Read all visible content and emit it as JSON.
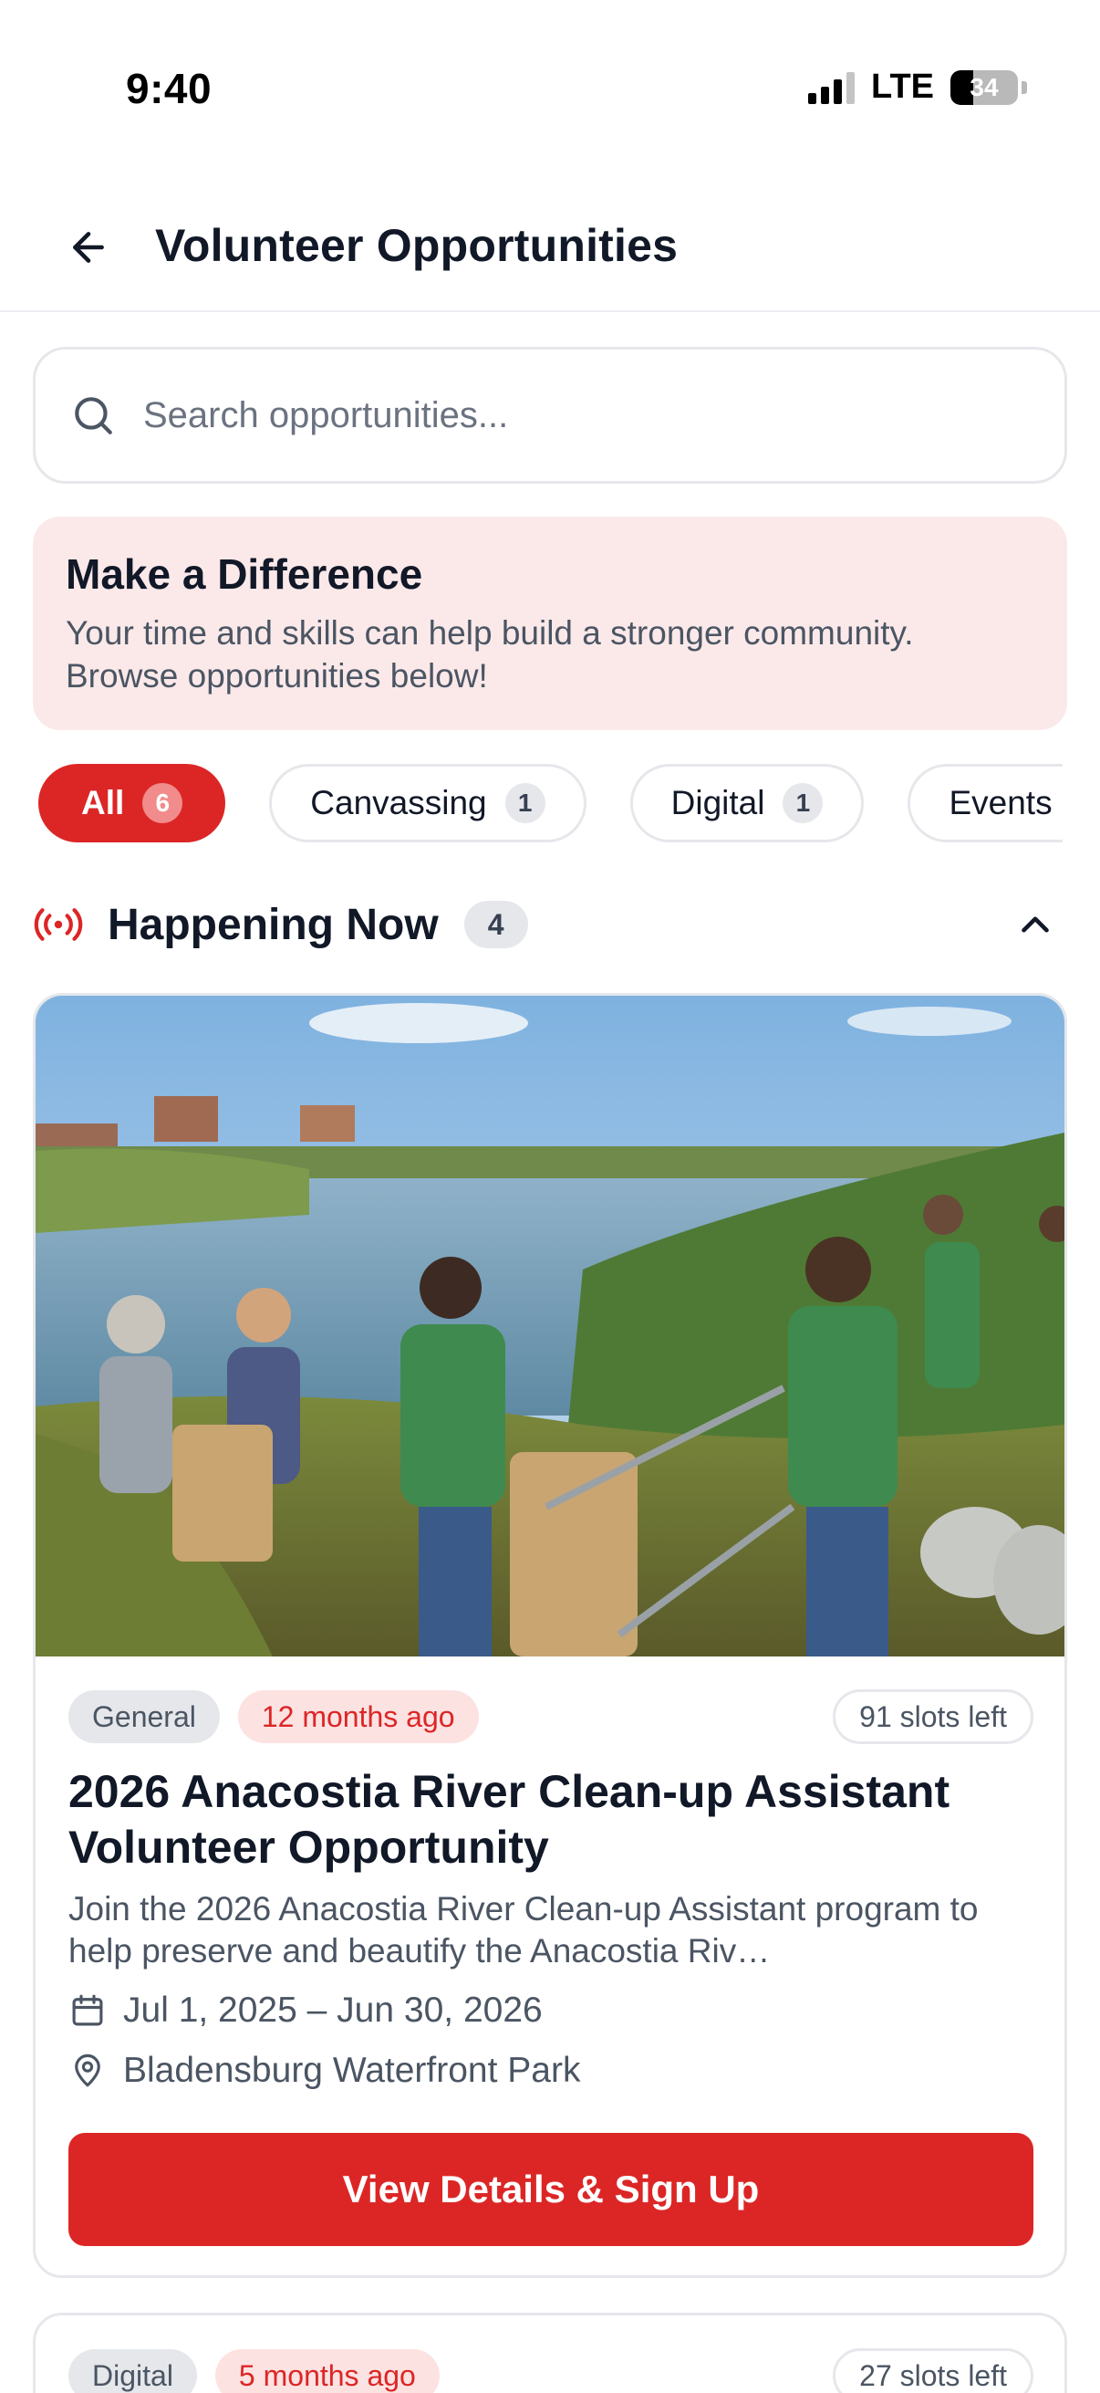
{
  "status_bar": {
    "time": "9:40",
    "network": "LTE",
    "battery": "34",
    "battery_level": 0.34
  },
  "header": {
    "title": "Volunteer Opportunities"
  },
  "search": {
    "placeholder": "Search opportunities..."
  },
  "banner": {
    "title": "Make a Difference",
    "text": "Your time and skills can help build a stronger community. Browse opportunities below!"
  },
  "filters": [
    {
      "label": "All",
      "count": "6",
      "active": true
    },
    {
      "label": "Canvassing",
      "count": "1"
    },
    {
      "label": "Digital",
      "count": "1"
    },
    {
      "label": "Events"
    }
  ],
  "section": {
    "title": "Happening Now",
    "count": "4"
  },
  "cards": [
    {
      "category": "General",
      "posted": "12 months ago",
      "slots": "91 slots left",
      "title": "2026 Anacostia River Clean-up Assistant Volunteer Opportunity",
      "description": "Join the 2026 Anacostia River Clean-up Assistant program to help preserve and beautify the Anacostia Riv…",
      "dates": "Jul 1, 2025 – Jun 30, 2026",
      "location": "Bladensburg Waterfront Park",
      "cta": "View Details & Sign Up"
    },
    {
      "category": "Digital",
      "posted": "5 months ago",
      "slots": "27 slots left"
    }
  ],
  "colors": {
    "accent": "#dc2626",
    "banner_bg": "#fbe9e9",
    "tag_time_bg": "#fde2e2"
  }
}
